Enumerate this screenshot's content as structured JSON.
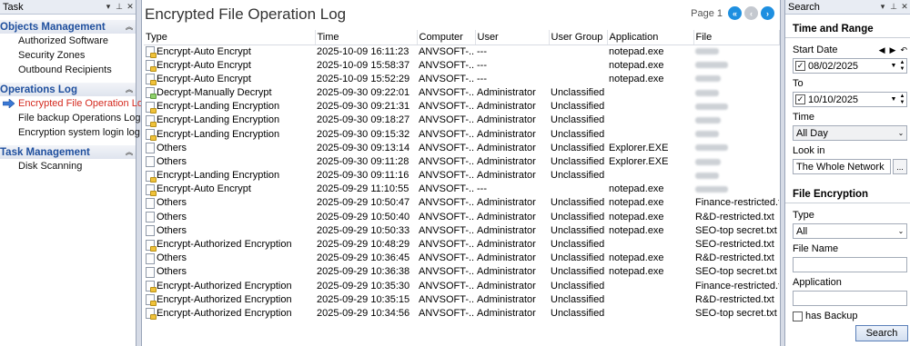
{
  "task_pane": {
    "title": "Task",
    "sections": [
      {
        "title": "Objects Management",
        "items": [
          "Authorized Software",
          "Security Zones",
          "Outbound Recipients"
        ]
      },
      {
        "title": "Operations Log",
        "items": [
          "Encrypted File Operation Log",
          "File backup Operations Log",
          "Encryption system login log"
        ]
      },
      {
        "title": "Task Management",
        "items": [
          "Disk Scanning"
        ]
      }
    ]
  },
  "main": {
    "title": "Encrypted File Operation Log",
    "pager_label": "Page 1",
    "columns": [
      "Type",
      "Time",
      "Computer",
      "User",
      "User Group",
      "Application",
      "File"
    ],
    "rows": [
      {
        "icon": "lock",
        "type": "Encrypt-Auto Encrypt",
        "time": "2025-10-09 16:11:23",
        "computer": "ANVSOFT-...",
        "user": "---",
        "group": "",
        "app": "notepad.exe",
        "file": ""
      },
      {
        "icon": "lock",
        "type": "Encrypt-Auto Encrypt",
        "time": "2025-10-09 15:58:37",
        "computer": "ANVSOFT-...",
        "user": "---",
        "group": "",
        "app": "notepad.exe",
        "file": ""
      },
      {
        "icon": "lock",
        "type": "Encrypt-Auto Encrypt",
        "time": "2025-10-09 15:52:29",
        "computer": "ANVSOFT-...",
        "user": "---",
        "group": "",
        "app": "notepad.exe",
        "file": ""
      },
      {
        "icon": "unlock",
        "type": "Decrypt-Manually Decrypt",
        "time": "2025-09-30 09:22:01",
        "computer": "ANVSOFT-...",
        "user": "Administrator",
        "group": "Unclassified",
        "app": "",
        "file": ""
      },
      {
        "icon": "lock",
        "type": "Encrypt-Landing Encryption",
        "time": "2025-09-30 09:21:31",
        "computer": "ANVSOFT-...",
        "user": "Administrator",
        "group": "Unclassified",
        "app": "",
        "file": ""
      },
      {
        "icon": "lock",
        "type": "Encrypt-Landing Encryption",
        "time": "2025-09-30 09:18:27",
        "computer": "ANVSOFT-...",
        "user": "Administrator",
        "group": "Unclassified",
        "app": "",
        "file": ""
      },
      {
        "icon": "lock",
        "type": "Encrypt-Landing Encryption",
        "time": "2025-09-30 09:15:32",
        "computer": "ANVSOFT-...",
        "user": "Administrator",
        "group": "Unclassified",
        "app": "",
        "file": ""
      },
      {
        "icon": "doc",
        "type": "Others",
        "time": "2025-09-30 09:13:14",
        "computer": "ANVSOFT-...",
        "user": "Administrator",
        "group": "Unclassified",
        "app": "Explorer.EXE",
        "file": ""
      },
      {
        "icon": "doc",
        "type": "Others",
        "time": "2025-09-30 09:11:28",
        "computer": "ANVSOFT-...",
        "user": "Administrator",
        "group": "Unclassified",
        "app": "Explorer.EXE",
        "file": ""
      },
      {
        "icon": "lock",
        "type": "Encrypt-Landing Encryption",
        "time": "2025-09-30 09:11:16",
        "computer": "ANVSOFT-...",
        "user": "Administrator",
        "group": "Unclassified",
        "app": "",
        "file": ""
      },
      {
        "icon": "lock",
        "type": "Encrypt-Auto Encrypt",
        "time": "2025-09-29 11:10:55",
        "computer": "ANVSOFT-...",
        "user": "---",
        "group": "",
        "app": "notepad.exe",
        "file": ""
      },
      {
        "icon": "doc",
        "type": "Others",
        "time": "2025-09-29 10:50:47",
        "computer": "ANVSOFT-...",
        "user": "Administrator",
        "group": "Unclassified",
        "app": "notepad.exe",
        "file": "Finance-restricted.txt"
      },
      {
        "icon": "doc",
        "type": "Others",
        "time": "2025-09-29 10:50:40",
        "computer": "ANVSOFT-...",
        "user": "Administrator",
        "group": "Unclassified",
        "app": "notepad.exe",
        "file": "R&D-restricted.txt"
      },
      {
        "icon": "doc",
        "type": "Others",
        "time": "2025-09-29 10:50:33",
        "computer": "ANVSOFT-...",
        "user": "Administrator",
        "group": "Unclassified",
        "app": "notepad.exe",
        "file": "SEO-top secret.txt"
      },
      {
        "icon": "lock",
        "type": "Encrypt-Authorized Encryption",
        "time": "2025-09-29 10:48:29",
        "computer": "ANVSOFT-...",
        "user": "Administrator",
        "group": "Unclassified",
        "app": "",
        "file": "SEO-restricted.txt"
      },
      {
        "icon": "doc",
        "type": "Others",
        "time": "2025-09-29 10:36:45",
        "computer": "ANVSOFT-...",
        "user": "Administrator",
        "group": "Unclassified",
        "app": "notepad.exe",
        "file": "R&D-restricted.txt"
      },
      {
        "icon": "doc",
        "type": "Others",
        "time": "2025-09-29 10:36:38",
        "computer": "ANVSOFT-...",
        "user": "Administrator",
        "group": "Unclassified",
        "app": "notepad.exe",
        "file": "SEO-top secret.txt"
      },
      {
        "icon": "lock",
        "type": "Encrypt-Authorized Encryption",
        "time": "2025-09-29 10:35:30",
        "computer": "ANVSOFT-...",
        "user": "Administrator",
        "group": "Unclassified",
        "app": "",
        "file": "Finance-restricted.txt"
      },
      {
        "icon": "lock",
        "type": "Encrypt-Authorized Encryption",
        "time": "2025-09-29 10:35:15",
        "computer": "ANVSOFT-...",
        "user": "Administrator",
        "group": "Unclassified",
        "app": "",
        "file": "R&D-restricted.txt"
      },
      {
        "icon": "lock",
        "type": "Encrypt-Authorized Encryption",
        "time": "2025-09-29 10:34:56",
        "computer": "ANVSOFT-...",
        "user": "Administrator",
        "group": "Unclassified",
        "app": "",
        "file": "SEO-top secret.txt"
      }
    ]
  },
  "search": {
    "title": "Search",
    "time_range_title": "Time and Range",
    "start_label": "Start Date",
    "start_value": "08/02/2025",
    "to_label": "To",
    "to_value": "10/10/2025",
    "time_label": "Time",
    "time_value": "All Day",
    "look_in_label": "Look in",
    "look_in_value": "The Whole Network",
    "browse_label": "...",
    "file_enc_title": "File Encryption",
    "type_label": "Type",
    "type_value": "All",
    "file_name_label": "File Name",
    "file_name_value": "",
    "application_label": "Application",
    "application_value": "",
    "has_backup_label": "has Backup",
    "search_button": "Search"
  },
  "colors": {
    "accent": "#1f4f9e",
    "active": "#d42a1f",
    "pager": "#1e8fe0"
  }
}
